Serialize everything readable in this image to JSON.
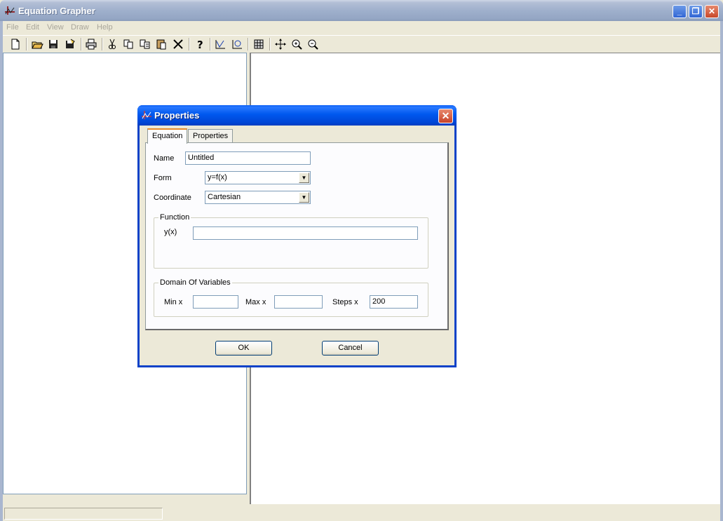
{
  "app": {
    "title": "Equation Grapher",
    "window_buttons": [
      "_",
      "❐",
      "✕"
    ]
  },
  "menu": [
    "File",
    "Edit",
    "View",
    "Draw",
    "Help"
  ],
  "toolbar": {
    "icons": [
      "new-file-icon",
      "open-folder-icon",
      "save-icon",
      "save-as-icon",
      "print-icon",
      "cut-icon",
      "copy-icon",
      "copy-special-icon",
      "paste-icon",
      "delete-icon",
      "help-icon",
      "axes-icon",
      "graph-fit-icon",
      "grid-icon",
      "pan-icon",
      "zoom-in-icon",
      "zoom-out-icon"
    ]
  },
  "dialog": {
    "title": "Properties",
    "close_label": "✕",
    "tabs": [
      {
        "label": "Equation",
        "active": true
      },
      {
        "label": "Properties",
        "active": false
      }
    ],
    "name_label": "Name",
    "name_value": "Untitled",
    "form_label": "Form",
    "form_value": "y=f(x)",
    "coordinate_label": "Coordinate",
    "coordinate_value": "Cartesian",
    "function_group": "Function",
    "yx_label": "y(x)",
    "yx_value": "",
    "domain_group": "Domain Of Variables",
    "minx_label": "Min x",
    "minx_value": "",
    "maxx_label": "Max x",
    "maxx_value": "",
    "steps_label": "Steps x",
    "steps_value": "200",
    "ok_label": "OK",
    "cancel_label": "Cancel"
  }
}
